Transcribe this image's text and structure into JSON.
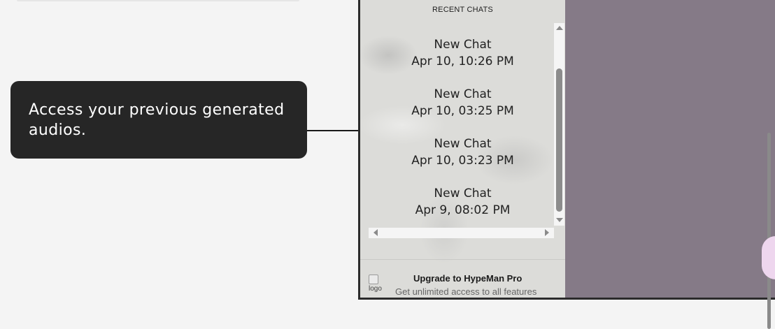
{
  "tooltip": {
    "text": "Access your previous generated audios."
  },
  "sidebar": {
    "recent_title": "RECENT CHATS",
    "chats": [
      {
        "name": "New Chat",
        "date": "Apr 10, 10:26 PM"
      },
      {
        "name": "New Chat",
        "date": "Apr 10, 03:25 PM"
      },
      {
        "name": "New Chat",
        "date": "Apr 10, 03:23 PM"
      },
      {
        "name": "New Chat",
        "date": "Apr 9, 08:02 PM"
      }
    ],
    "upgrade": {
      "logo_alt": "logo",
      "title": "Upgrade to HypeMan Pro",
      "subtitle": "Get unlimited access to all features"
    }
  },
  "colors": {
    "tooltip_bg": "#262626",
    "main_panel": "#857a87",
    "page_bg": "#f4f4f4",
    "accent_pink": "#eed6ee"
  }
}
